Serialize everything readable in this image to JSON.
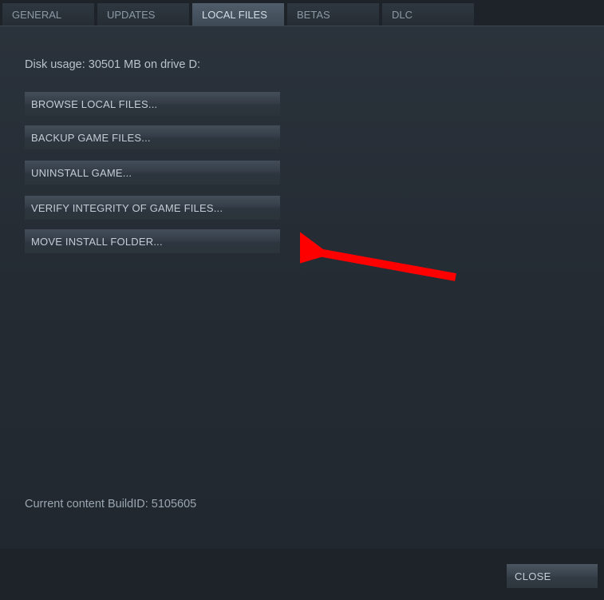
{
  "tabs": {
    "general": "GENERAL",
    "updates": "UPDATES",
    "local_files": "LOCAL FILES",
    "betas": "BETAS",
    "dlc": "DLC"
  },
  "disk_usage": "Disk usage: 30501 MB on drive D:",
  "buttons": {
    "browse": "BROWSE LOCAL FILES...",
    "backup": "BACKUP GAME FILES...",
    "uninstall": "UNINSTALL GAME...",
    "verify": "VERIFY INTEGRITY OF GAME FILES...",
    "move": "MOVE INSTALL FOLDER..."
  },
  "build_id": "Current content BuildID: 5105605",
  "close": "CLOSE"
}
